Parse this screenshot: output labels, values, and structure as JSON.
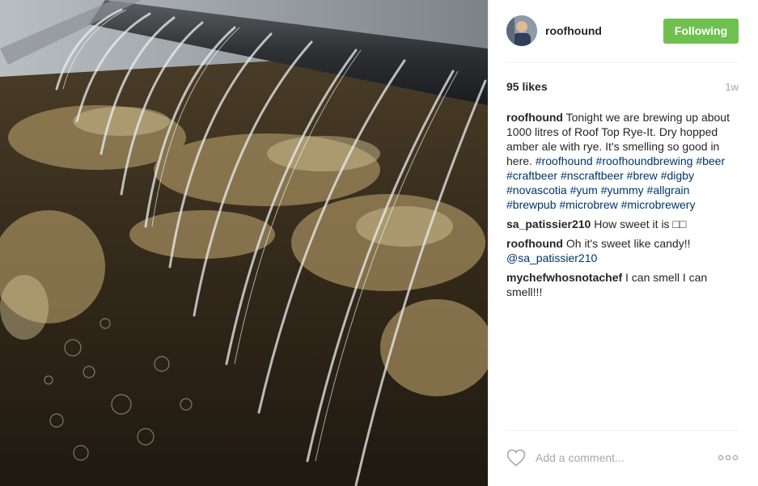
{
  "post": {
    "photo_alt": "",
    "header": {
      "username": "roofhound",
      "follow_button": "Following",
      "follow_color": "#70c050"
    },
    "likes": "95 likes",
    "time_ago": "1w",
    "caption": {
      "username": "roofhound",
      "text": "Tonight we are brewing up about 1000 litres of Roof Top Rye-It. Dry hopped amber ale with rye. It's smelling so good in here.",
      "hashtags": [
        "#roofhound",
        "#roofhoundbrewing",
        "#beer",
        "#craftbeer",
        "#nscraftbeer",
        "#brew",
        "#digby",
        "#novascotia",
        "#yum",
        "#yummy",
        "#allgrain",
        "#brewpub",
        "#microbrew",
        "#microbrewery"
      ]
    },
    "comments": [
      {
        "username": "sa_patissier210",
        "text": "How sweet it is □□",
        "mention": ""
      },
      {
        "username": "roofhound",
        "text": "Oh it's sweet like candy!!",
        "mention": "@sa_patissier210"
      },
      {
        "username": "mychefwhosnotachef",
        "text": "I can smell I can smell!!!",
        "mention": ""
      }
    ],
    "footer": {
      "comment_placeholder": "Add a comment...",
      "like_icon": "heart-outline-icon",
      "more_icon": "more-options-icon"
    },
    "colors": {
      "link": "#003569",
      "muted": "#a5a7aa",
      "text": "#262626"
    }
  }
}
